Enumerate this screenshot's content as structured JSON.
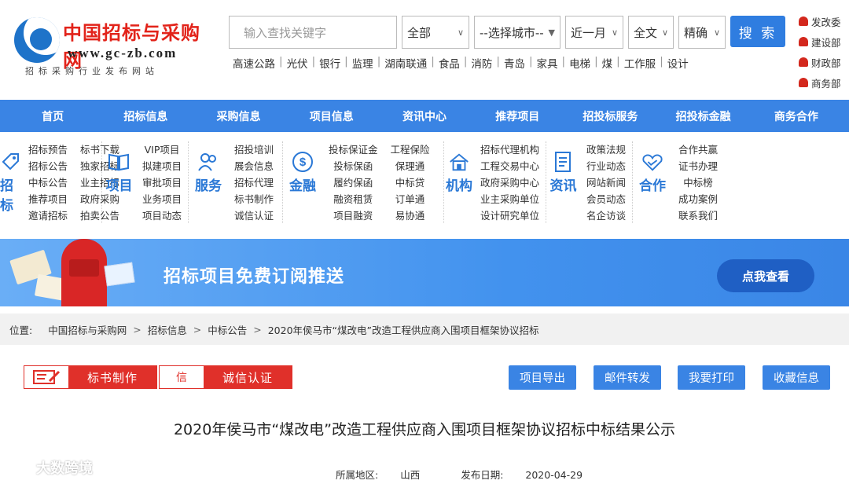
{
  "site": {
    "title": "中国招标与采购网",
    "url": "www.gc-zb.com",
    "subtitle": "招标采购行业发布网站"
  },
  "search": {
    "placeholder": "输入查找关键字",
    "scope": "全部",
    "city": "--选择城市--",
    "period": "近一月",
    "text_scope": "全文",
    "precision": "精确",
    "button": "搜 索"
  },
  "hot_keywords": [
    "高速公路",
    "光伏",
    "银行",
    "监理",
    "湖南联通",
    "食品",
    "消防",
    "青岛",
    "家具",
    "电梯",
    "煤",
    "工作服",
    "设计"
  ],
  "side_links": [
    "发改委",
    "建设部",
    "财政部",
    "商务部"
  ],
  "nav": [
    "首页",
    "招标信息",
    "采购信息",
    "项目信息",
    "资讯中心",
    "推荐项目",
    "招投标服务",
    "招投标金融",
    "商务合作"
  ],
  "services": [
    {
      "name": "招标",
      "icon": "tag-icon",
      "cols": [
        [
          "招标预告",
          "招标公告",
          "中标公告",
          "推荐项目",
          "邀请招标"
        ],
        [
          "标书下载",
          "独家招标",
          "业主招标",
          "政府采购",
          "拍卖公告"
        ]
      ]
    },
    {
      "name": "项目",
      "icon": "book-icon",
      "cols": [
        [
          "VIP项目",
          "拟建项目",
          "审批项目",
          "业务项目",
          "项目动态"
        ]
      ]
    },
    {
      "name": "服务",
      "icon": "people-icon",
      "cols": [
        [
          "招投培训",
          "展会信息",
          "招标代理",
          "标书制作",
          "诚信认证"
        ]
      ]
    },
    {
      "name": "金融",
      "icon": "dollar-icon",
      "cols": [
        [
          "投标保证金",
          "投标保函",
          "履约保函",
          "融资租赁",
          "项目融资"
        ],
        [
          "工程保险",
          "保理通",
          "中标贷",
          "订单通",
          "易协通"
        ]
      ]
    },
    {
      "name": "机构",
      "icon": "house-icon",
      "cols": [
        [
          "招标代理机构",
          "工程交易中心",
          "政府采购中心",
          "业主采购单位",
          "设计研究单位"
        ]
      ]
    },
    {
      "name": "资讯",
      "icon": "document-icon",
      "cols": [
        [
          "政策法规",
          "行业动态",
          "网站新闻",
          "会员动态",
          "名企访谈"
        ]
      ]
    },
    {
      "name": "合作",
      "icon": "handshake-icon",
      "cols": [
        [
          "合作共赢",
          "证书办理",
          "中标榜",
          "成功案例",
          "联系我们"
        ]
      ]
    }
  ],
  "banner": {
    "text": "招标项目免费订阅推送",
    "button": "点我查看"
  },
  "breadcrumb": {
    "label": "位置:",
    "items": [
      "中国招标与采购网",
      "招标信息",
      "中标公告",
      "2020年侯马市“煤改电”改造工程供应商入围项目框架协议招标"
    ]
  },
  "tools": {
    "bid_doc": "标书制作",
    "credit": "诚信认证",
    "credit_icon_text": "信",
    "export": "项目导出",
    "mail": "邮件转发",
    "print": "我要打印",
    "favorite": "收藏信息"
  },
  "article": {
    "title": "2020年侯马市“煤改电”改造工程供应商入围项目框架协议招标中标结果公示",
    "region_label": "所属地区:",
    "region": "山西",
    "date_label": "发布日期:",
    "date": "2020-04-29"
  },
  "watermark": "大数跨境",
  "colors": {
    "primary": "#3a84e4",
    "accent_red": "#e0302a",
    "logo_red": "#e2231a"
  }
}
